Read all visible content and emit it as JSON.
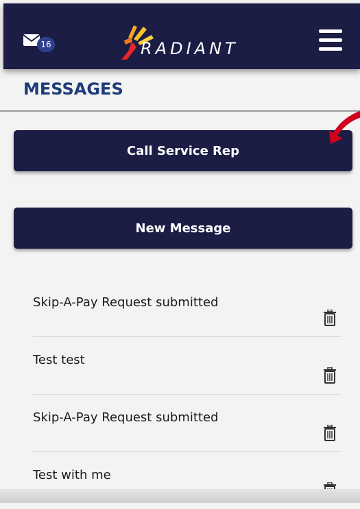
{
  "header": {
    "mail_icon": "envelope-icon",
    "unread_count": "16",
    "logo_text": "RADIANT",
    "menu_icon": "hamburger-menu-icon",
    "background_color": "#1b1d45"
  },
  "page": {
    "title": "MESSAGES",
    "title_color": "#1f3b7a"
  },
  "actions": {
    "call_label": "Call Service Rep",
    "new_label": "New Message"
  },
  "messages": [
    {
      "subject": "Skip-A-Pay Request submitted",
      "icon": "trash-icon"
    },
    {
      "subject": "Test test",
      "icon": "trash-icon"
    },
    {
      "subject": "Skip-A-Pay Request submitted",
      "icon": "trash-icon"
    },
    {
      "subject": "Test with me",
      "icon": "trash-icon"
    }
  ],
  "annotation_color": "#d0021b"
}
